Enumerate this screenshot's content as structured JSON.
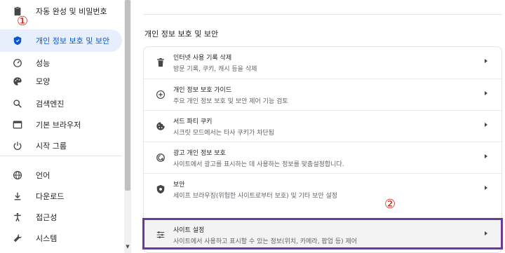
{
  "sidebar": {
    "items": [
      {
        "label": "자동 완성 및 비밀번호",
        "icon": "clipboard-icon"
      },
      {
        "label": "개인 정보 보호 및 보안",
        "icon": "shield-icon",
        "active": true
      },
      {
        "label": "성능",
        "icon": "speedometer-icon"
      },
      {
        "label": "모양",
        "icon": "palette-icon"
      },
      {
        "label": "검색엔진",
        "icon": "search-icon"
      },
      {
        "label": "기본 브라우저",
        "icon": "browser-window-icon"
      },
      {
        "label": "시작 그룹",
        "icon": "power-icon"
      },
      {
        "label": "언어",
        "icon": "globe-icon"
      },
      {
        "label": "다운로드",
        "icon": "download-icon"
      },
      {
        "label": "접근성",
        "icon": "accessibility-icon"
      },
      {
        "label": "시스템",
        "icon": "wrench-icon"
      }
    ]
  },
  "main": {
    "section_title": "개인 정보 보호 및 보안",
    "rows": [
      {
        "title": "인터넷 사용 기록 삭제",
        "desc": "방문 기록, 쿠키, 캐시 등을 삭제",
        "icon": "trash-icon"
      },
      {
        "title": "개인 정보 보호 가이드",
        "desc": "주요 개인 정보 보호 및 보안 제어 기능 검토",
        "icon": "add-circle-icon"
      },
      {
        "title": "서드 파티 쿠키",
        "desc": "시크릿 모드에서는 타사 쿠키가 차단됨",
        "icon": "cookie-icon"
      },
      {
        "title": "광고 개인 정보 보호",
        "desc": "사이트에서 광고를 표시하는 데 사용하는 정보를 맞춤설정합니다.",
        "icon": "ad-privacy-icon"
      },
      {
        "title": "보안",
        "desc": "세이프 브라우징(위험한 사이트로부터 보호) 및 기타 보안 설정",
        "icon": "security-shield-icon"
      },
      {
        "title": "사이트 설정",
        "desc": "사이트에서 사용하고 표시할 수 있는 정보(위치, 카메라, 팝업 등) 제어",
        "icon": "sliders-icon"
      }
    ]
  },
  "annotations": {
    "marker1": "①",
    "marker2": "②",
    "marker_color": "#e51400",
    "highlight_box_color": "#6b3a9f"
  },
  "colors": {
    "accent": "#0b57d0",
    "active_bg": "#e7eefc"
  }
}
